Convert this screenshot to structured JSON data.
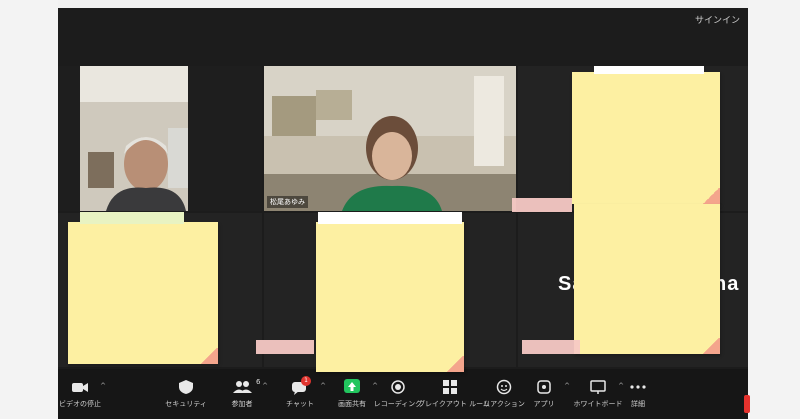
{
  "window": {
    "signin_label": "サインイン"
  },
  "participants": [
    {
      "id": "p1",
      "name": "",
      "active": true
    },
    {
      "id": "p2",
      "name": "松尾あゆみ",
      "active": false
    },
    {
      "id": "p3",
      "name": "",
      "active": false
    },
    {
      "id": "p4",
      "name": "",
      "active": false
    },
    {
      "id": "p5",
      "name": "",
      "active": false
    },
    {
      "id": "p6",
      "name_fragment_left": "Sa",
      "name_fragment_right": "na",
      "active": false
    }
  ],
  "toolbar": {
    "items": [
      {
        "label": "ビデオの停止",
        "icon": "video-camera-icon"
      },
      {
        "label": "セキュリティ",
        "icon": "shield-icon"
      },
      {
        "label": "参加者",
        "icon": "participants-icon",
        "count": "6"
      },
      {
        "label": "チャット",
        "icon": "chat-icon",
        "badge": "1"
      },
      {
        "label": "画面共有",
        "icon": "share-screen-icon"
      },
      {
        "label": "レコーディング",
        "icon": "record-icon"
      },
      {
        "label": "ブレイクアウト ルーム",
        "icon": "breakout-rooms-icon"
      },
      {
        "label": "リアクション",
        "icon": "reaction-icon"
      },
      {
        "label": "アプリ",
        "icon": "apps-icon"
      },
      {
        "label": "ホワイトボード",
        "icon": "whiteboard-icon"
      },
      {
        "label": "詳細",
        "icon": "more-icon"
      }
    ]
  },
  "colors": {
    "active_border": "#b8d86a",
    "share_green": "#22c55e",
    "sticky_note": "#fdf0a2",
    "badge_red": "#e0352f"
  }
}
